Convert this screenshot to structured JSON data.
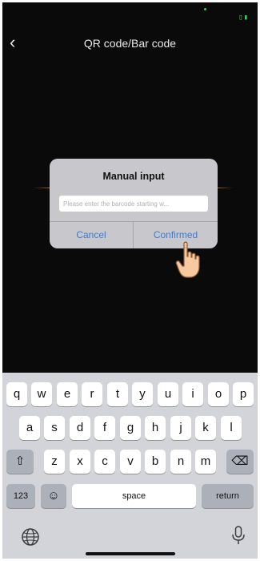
{
  "status_bar": {
    "battery_glyph": "▯▮"
  },
  "header": {
    "back_glyph": "‹",
    "title": "QR code/Bar code"
  },
  "dialog": {
    "title": "Manual input",
    "input_placeholder": "Please enter the barcode starting w...",
    "input_value": "",
    "cancel_label": "Cancel",
    "confirm_label": "Confirmed"
  },
  "keyboard": {
    "row1": [
      "q",
      "w",
      "e",
      "r",
      "t",
      "y",
      "u",
      "i",
      "o",
      "p"
    ],
    "row2": [
      "a",
      "s",
      "d",
      "f",
      "g",
      "h",
      "j",
      "k",
      "l"
    ],
    "row3": [
      "z",
      "x",
      "c",
      "v",
      "b",
      "n",
      "m"
    ],
    "shift_glyph": "⇧",
    "delete_glyph": "⌫",
    "numbers_label": "123",
    "emoji_glyph": "☺",
    "space_label": "space",
    "return_label": "return",
    "globe_icon": "globe-icon",
    "mic_icon": "mic-icon"
  },
  "colors": {
    "accent": "#3a7bd5",
    "scan_line": "#b87a2b",
    "status_green": "#3ccf55"
  }
}
